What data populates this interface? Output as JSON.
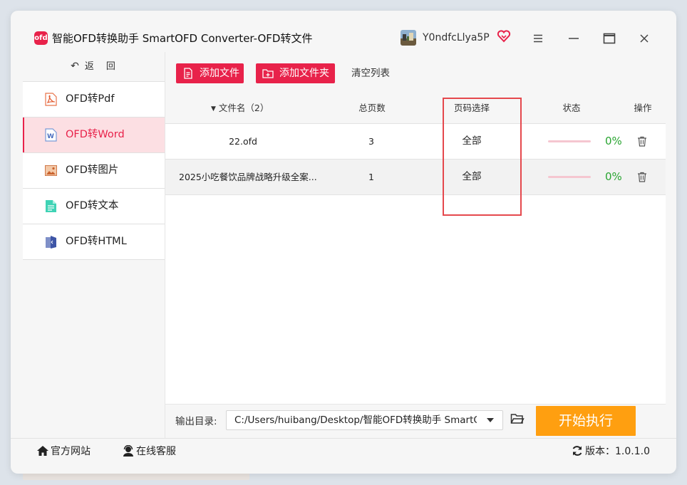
{
  "window": {
    "title": "智能OFD转换助手 SmartOFD Converter-OFD转文件",
    "logo_text": "ofd",
    "username": "Y0ndfcLlya5P",
    "accent_color": "#e8224a"
  },
  "sidebar": {
    "back_label": "返　回",
    "items": [
      {
        "label": "OFD转Pdf",
        "icon": "pdf-icon",
        "active": false
      },
      {
        "label": "OFD转Word",
        "icon": "word-icon",
        "active": true
      },
      {
        "label": "OFD转图片",
        "icon": "image-icon",
        "active": false
      },
      {
        "label": "OFD转文本",
        "icon": "text-file-icon",
        "active": false
      },
      {
        "label": "OFD转HTML",
        "icon": "html-icon",
        "active": false
      }
    ]
  },
  "toolbar": {
    "add_file": "添加文件",
    "add_folder": "添加文件夹",
    "clear_list": "清空列表"
  },
  "table": {
    "headers": {
      "filename": "文件名（2）",
      "pages": "总页数",
      "page_select": "页码选择",
      "status": "状态",
      "actions": "操作"
    },
    "rows": [
      {
        "filename": "22.ofd",
        "pages": "3",
        "page_select": "全部",
        "progress": "0%"
      },
      {
        "filename": "2025小吃餐饮品牌战略升级全案...",
        "pages": "1",
        "page_select": "全部",
        "progress": "0%"
      }
    ]
  },
  "output": {
    "label": "输出目录:",
    "path": "C:/Users/huibang/Desktop/智能OFD转换助手 SmartOFD",
    "start_button": "开始执行",
    "start_color": "#ff9f10"
  },
  "statusbar": {
    "website": "官方网站",
    "support": "在线客服",
    "version": "版本：1.0.1.0"
  }
}
